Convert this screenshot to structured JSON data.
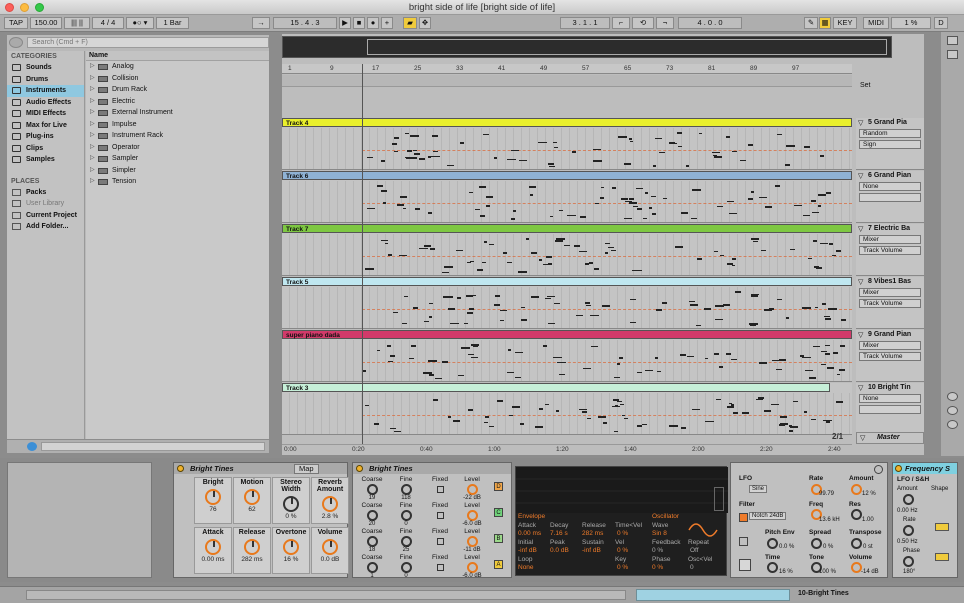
{
  "window": {
    "title": "bright side of life  [bright side of life]"
  },
  "transport": {
    "tap": "TAP",
    "tempo": "150.00",
    "sig": "4 / 4",
    "quant": "1 Bar",
    "position": "15 .  4 .  3",
    "loop_start": "3 .  1 .  1",
    "loop_len": "4 .  0 .  0",
    "key": "KEY",
    "midi": "MIDI",
    "cpu": "1 %",
    "d": "D"
  },
  "browser": {
    "search_placeholder": "Search (Cmd + F)",
    "categories_label": "CATEGORIES",
    "categories": [
      "Sounds",
      "Drums",
      "Instruments",
      "Audio Effects",
      "MIDI Effects",
      "Max for Live",
      "Plug-ins",
      "Clips",
      "Samples"
    ],
    "selected_category": "Instruments",
    "places_label": "PLACES",
    "places": [
      "Packs",
      "User Library",
      "Current Project",
      "Add Folder..."
    ],
    "name_header": "Name",
    "items": [
      "Analog",
      "Collision",
      "Drum Rack",
      "Electric",
      "External Instrument",
      "Impulse",
      "Instrument Rack",
      "Operator",
      "Sampler",
      "Simpler",
      "Tension"
    ]
  },
  "arrangement": {
    "bar_numbers": [
      "1",
      "9",
      "17",
      "25",
      "33",
      "41",
      "49",
      "57",
      "65",
      "73",
      "81",
      "89",
      "97"
    ],
    "set_label": "Set",
    "time_labels": [
      "0:00",
      "0:20",
      "0:40",
      "1:00",
      "1:20",
      "1:40",
      "2:00",
      "2:20",
      "2:40"
    ],
    "zoom": "2/1",
    "tracks": [
      {
        "clip": "Track 4",
        "color": "#e9f02c",
        "name": "5 Grand Pia",
        "sel1": "Random",
        "sel2": "Sign"
      },
      {
        "clip": "Track 6",
        "color": "#8fb2d4",
        "name": "6 Grand Pian",
        "sel1": "None",
        "sel2": ""
      },
      {
        "clip": "Track 7",
        "color": "#7ec842",
        "name": "7 Electric Ba",
        "sel1": "Mixer",
        "sel2": "Track Volume"
      },
      {
        "clip": "Track 5",
        "color": "#bfe7f0",
        "name": "8 Vibes1 Bas",
        "sel1": "Mixer",
        "sel2": "Track Volume"
      },
      {
        "clip": "super piano dada",
        "color": "#d23a6a",
        "name": "9 Grand Pian",
        "sel1": "Mixer",
        "sel2": "Track Volume"
      },
      {
        "clip": "Track 3",
        "color": "#c6efd8",
        "name": "10 Bright Tin",
        "sel1": "None",
        "sel2": ""
      }
    ],
    "master": "Master"
  },
  "devices": {
    "rack": {
      "title": "Bright Tines",
      "map": "Map",
      "macros": [
        {
          "label": "Bright",
          "value": "76"
        },
        {
          "label": "Motion",
          "value": "62"
        },
        {
          "label": "Stereo Width",
          "value": "0 %"
        },
        {
          "label": "Reverb Amount",
          "value": "2.8 %"
        },
        {
          "label": "Attack",
          "value": "0.00 ms"
        },
        {
          "label": "Release",
          "value": "282 ms"
        },
        {
          "label": "Overtone",
          "value": "16 %"
        },
        {
          "label": "Volume",
          "value": "0.0 dB"
        }
      ]
    },
    "operator": {
      "title": "Bright Tines",
      "rows": [
        {
          "coarse": "19",
          "fine": "118",
          "level": "-22 dB",
          "box": "D"
        },
        {
          "coarse": "20",
          "fine": "0",
          "level": "-6.0 dB",
          "box": "C"
        },
        {
          "coarse": "18",
          "fine": "25",
          "level": "-11 dB",
          "box": "B"
        },
        {
          "coarse": "1",
          "fine": "0",
          "level": "-6.0 dB",
          "box": "A"
        }
      ],
      "labels": {
        "coarse": "Coarse",
        "fine": "Fine",
        "fixed": "Fixed",
        "level": "Level"
      }
    },
    "envelope": {
      "env_label": "Envelope",
      "osc_label": "Oscillator",
      "attack": "Attack",
      "attack_v": "0.00 ms",
      "decay": "Decay",
      "decay_v": "7.16 s",
      "release": "Release",
      "release_v": "282 ms",
      "timevel": "Time<Vel",
      "timevel_v": "0 %",
      "initial": "Initial",
      "initial_v": "-inf dB",
      "peak": "Peak",
      "peak_v": "0.0 dB",
      "sustain": "Sustain",
      "sustain_v": "-inf dB",
      "vel": "Vel",
      "vel_v": "0 %",
      "loop": "Loop",
      "loop_v": "None",
      "key": "Key",
      "key_v": "0 %",
      "wave": "Wave",
      "wave_v": "Sin 8",
      "feedback": "Feedback",
      "feedback_v": "0 %",
      "phase": "Phase",
      "phase_v": "0 %",
      "repeat": "Repeat",
      "repeat_v": "Off",
      "oscvel": "Osc<Vel",
      "oscvel_v": "0"
    },
    "lfo": {
      "lfo": "LFO",
      "lfo_wave": "Sine",
      "rate": "Rate",
      "rate_v": "99.79",
      "amount": "Amount",
      "amount_v": "12 %",
      "filter": "Filter",
      "filter_type": "Notch 24dB",
      "freq": "Freq",
      "freq_v": "13.6 kH",
      "res": "Res",
      "res_v": "1.00",
      "pitchenv": "Pitch Env",
      "pitchenv_v": "0.0 %",
      "spread": "Spread",
      "spread_v": "0 %",
      "transpose": "Transpose",
      "transpose_v": "0 st",
      "time": "Time",
      "time_v": "16 %",
      "tone": "Tone",
      "tone_v": "100 %",
      "volume": "Volume",
      "volume_v": "-14 dB"
    },
    "freq": {
      "title": "Frequency S",
      "lfo_sh": "LFO / S&H",
      "amount": "Amount",
      "shape": "Shape",
      "amount_v": "0.00 Hz",
      "rate": "Rate",
      "rate_v": "0.50 Hz",
      "phase": "Phase",
      "phase_v": "180°"
    }
  },
  "status": {
    "track": "10-Bright Tines"
  },
  "colors": {
    "accent": "#f0cb3c",
    "orange": "#e8791c",
    "select": "#8fc8e0"
  }
}
